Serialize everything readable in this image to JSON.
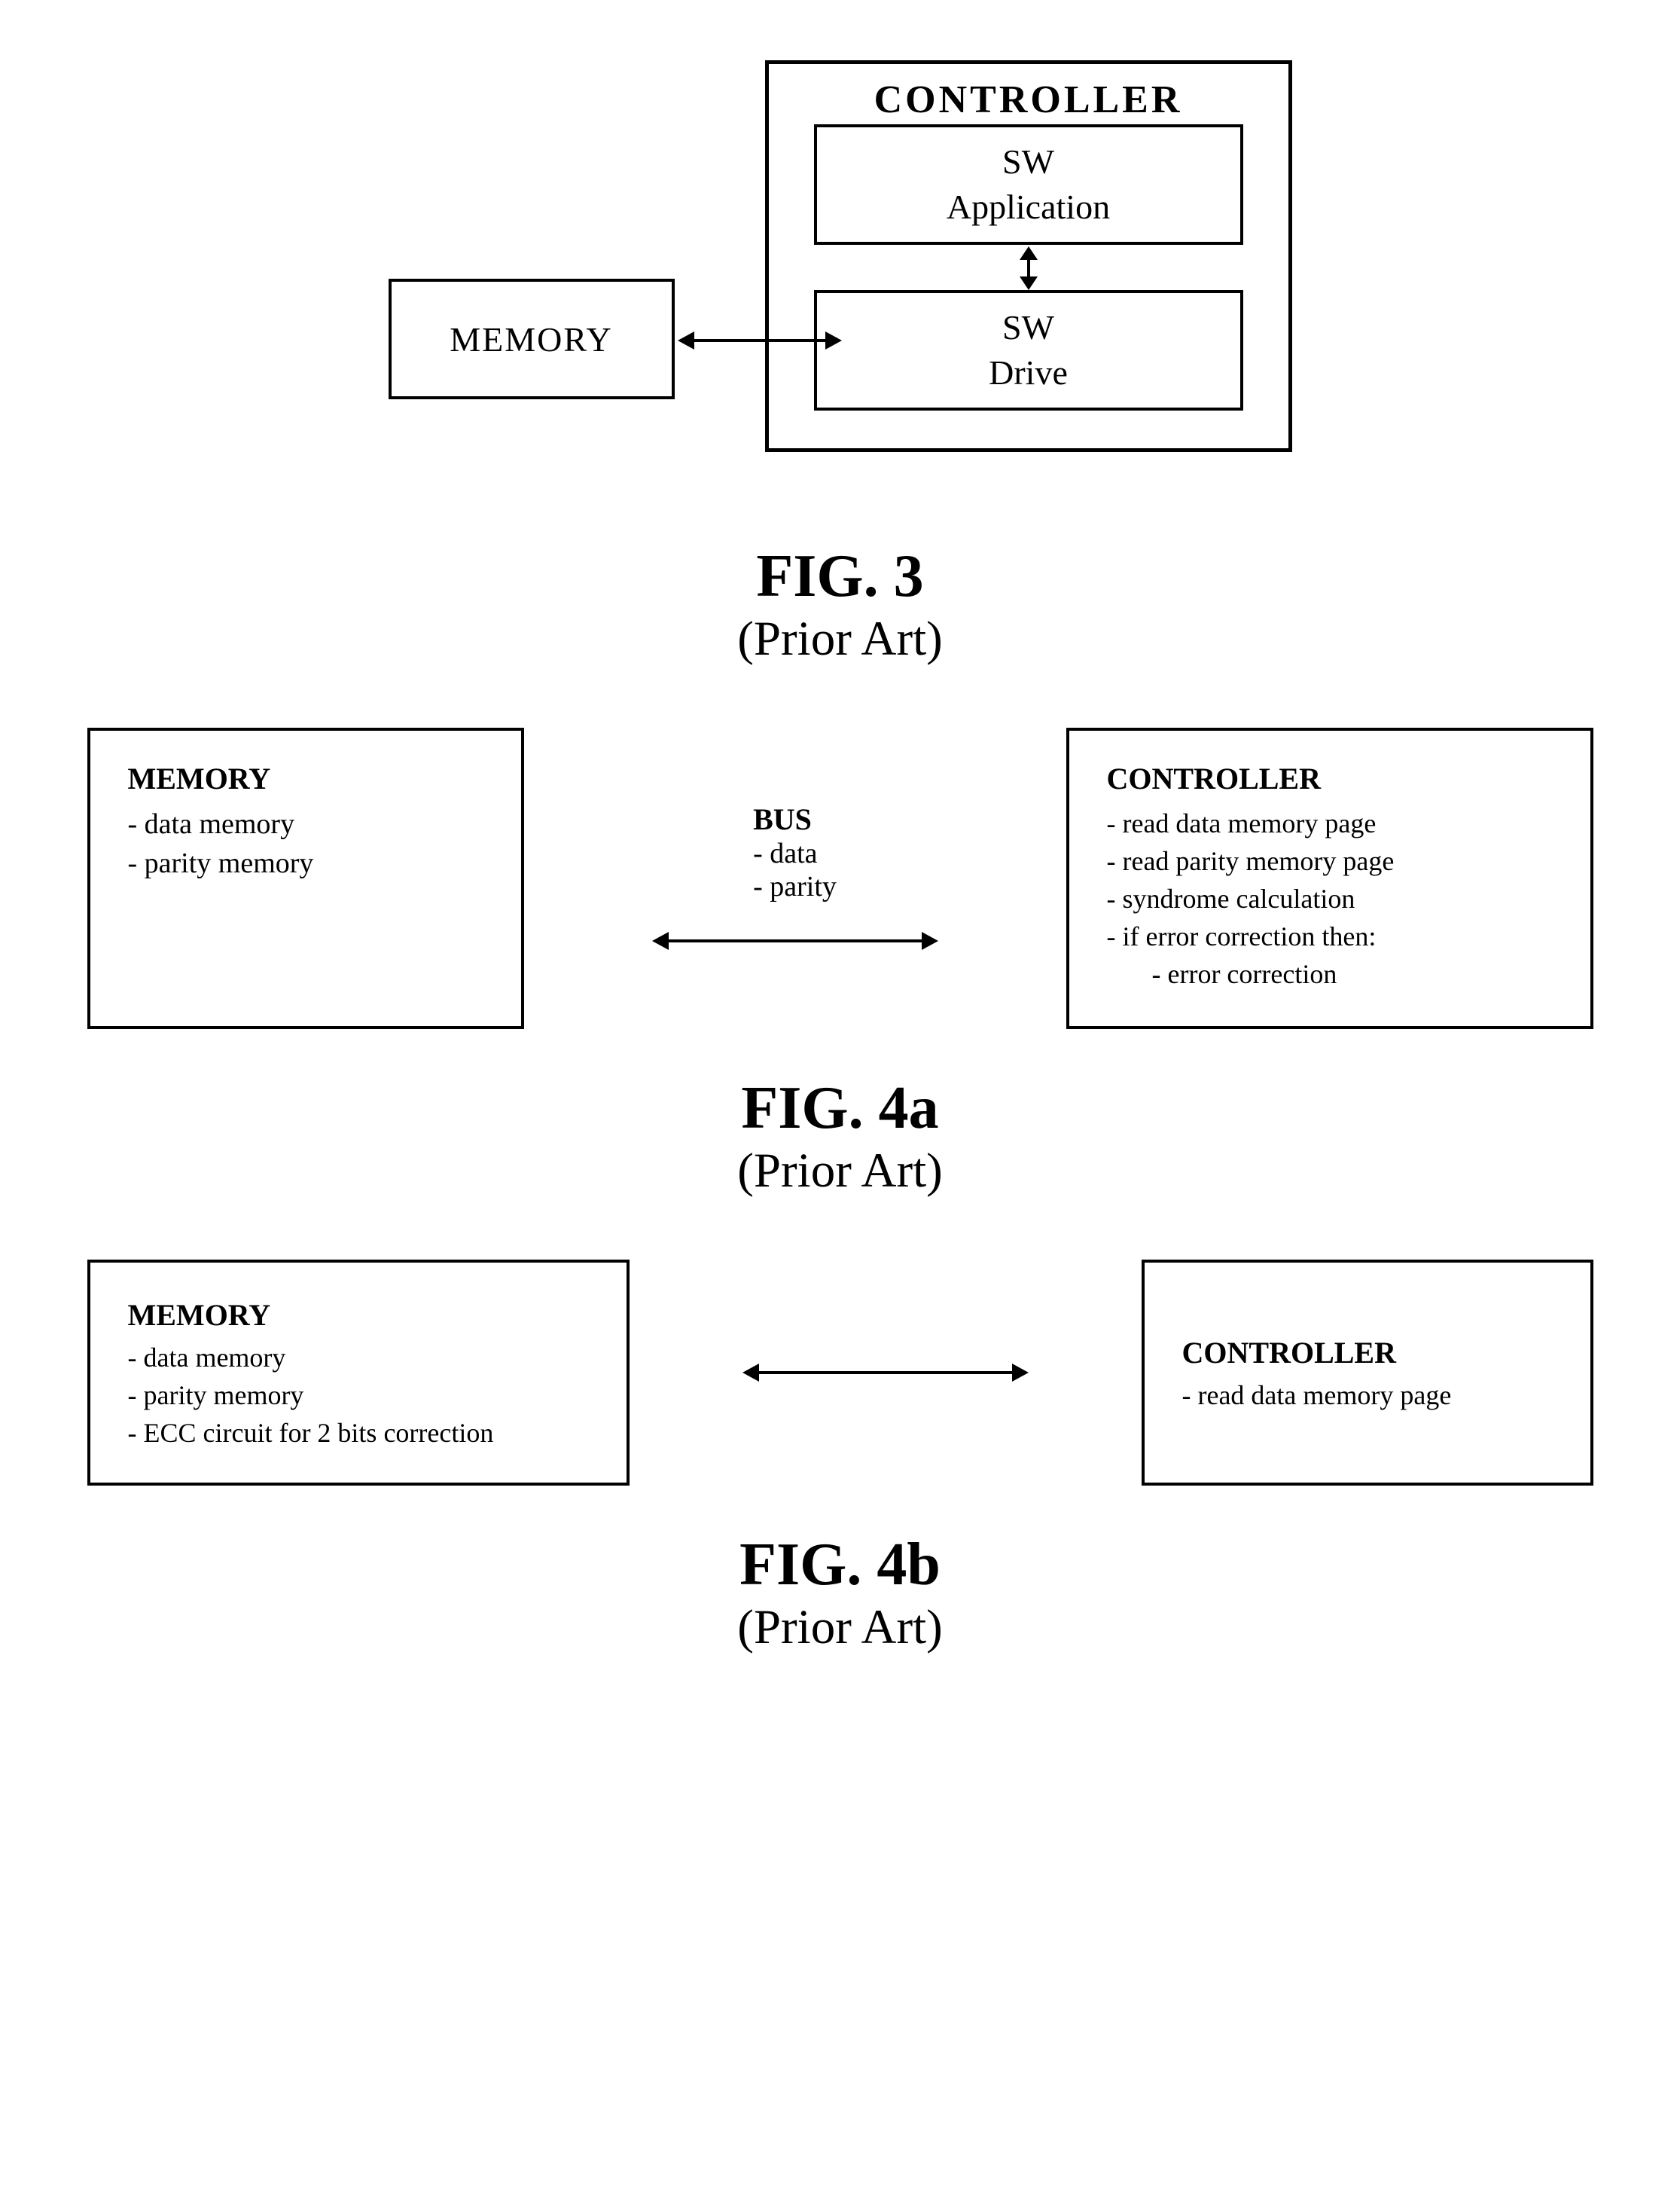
{
  "fig3": {
    "controller_label": "CONTROLLER",
    "sw_app_line1": "SW",
    "sw_app_line2": "Application",
    "sw_drive_line1": "SW",
    "sw_drive_line2": "Drive",
    "memory_label": "MEMORY",
    "caption_title": "FIG. 3",
    "caption_subtitle": "(Prior Art)"
  },
  "fig4a": {
    "memory_title": "MEMORY",
    "memory_items": [
      "- data memory",
      "- parity memory"
    ],
    "bus_title": "BUS",
    "bus_items": [
      "- data",
      "- parity"
    ],
    "controller_title": "CONTROLLER",
    "controller_items": [
      "- read data memory page",
      "- read parity memory page",
      "- syndrome calculation",
      "- if error correction then:",
      "    - error correction"
    ],
    "caption_title": "FIG. 4a",
    "caption_subtitle": "(Prior Art)"
  },
  "fig4b": {
    "memory_title": "MEMORY",
    "memory_items": [
      "- data memory",
      "- parity memory",
      "- ECC circuit for 2 bits correction"
    ],
    "controller_title": "CONTROLLER",
    "controller_items": [
      "- read data memory page"
    ],
    "caption_title": "FIG. 4b",
    "caption_subtitle": "(Prior Art)"
  }
}
